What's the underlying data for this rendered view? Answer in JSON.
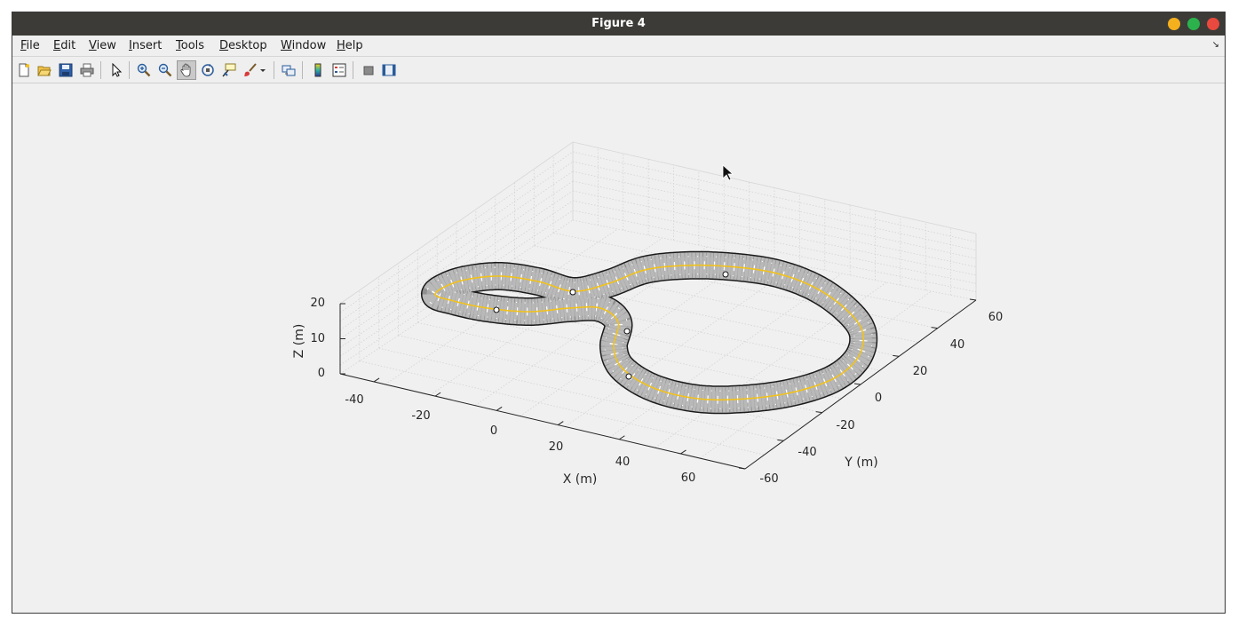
{
  "window": {
    "title": "Figure 4"
  },
  "menu": [
    {
      "label": "File",
      "accel": "F",
      "rest": "ile"
    },
    {
      "label": "Edit",
      "accel": "E",
      "rest": "dit"
    },
    {
      "label": "View",
      "accel": "V",
      "rest": "iew"
    },
    {
      "label": "Insert",
      "accel": "I",
      "rest": "nsert"
    },
    {
      "label": "Tools",
      "accel": "T",
      "rest": "ools"
    },
    {
      "label": "Desktop",
      "accel": "D",
      "rest": "esktop"
    },
    {
      "label": "Window",
      "accel": "W",
      "rest": "indow"
    },
    {
      "label": "Help",
      "accel": "H",
      "rest": "elp"
    }
  ],
  "toolbar": {
    "icons": [
      "new-figure-icon",
      "open-file-icon",
      "save-icon",
      "print-icon",
      "select-arrow-icon",
      "zoom-in-icon",
      "zoom-out-icon",
      "pan-hand-icon",
      "rotate-3d-icon",
      "data-cursor-icon",
      "brush-icon",
      "link-plot-icon",
      "colorbar-icon",
      "legend-icon",
      "hide-plot-tools-icon",
      "show-plot-tools-icon"
    ],
    "pressed": "pan-hand-icon"
  },
  "axes": {
    "xlabel": "X (m)",
    "ylabel": "Y (m)",
    "zlabel": "Z (m)",
    "xticks": [
      "-40",
      "-20",
      "0",
      "20",
      "40",
      "60"
    ],
    "yticks": [
      "-60",
      "-40",
      "-20",
      "0",
      "20",
      "40",
      "60"
    ],
    "zticks": [
      "0",
      "10",
      "20"
    ]
  },
  "colors": {
    "road": "#b9b9b9",
    "road_edge": "#1a1a1a",
    "center_line": "#f2c21b",
    "lane_marking": "#ffffff"
  }
}
